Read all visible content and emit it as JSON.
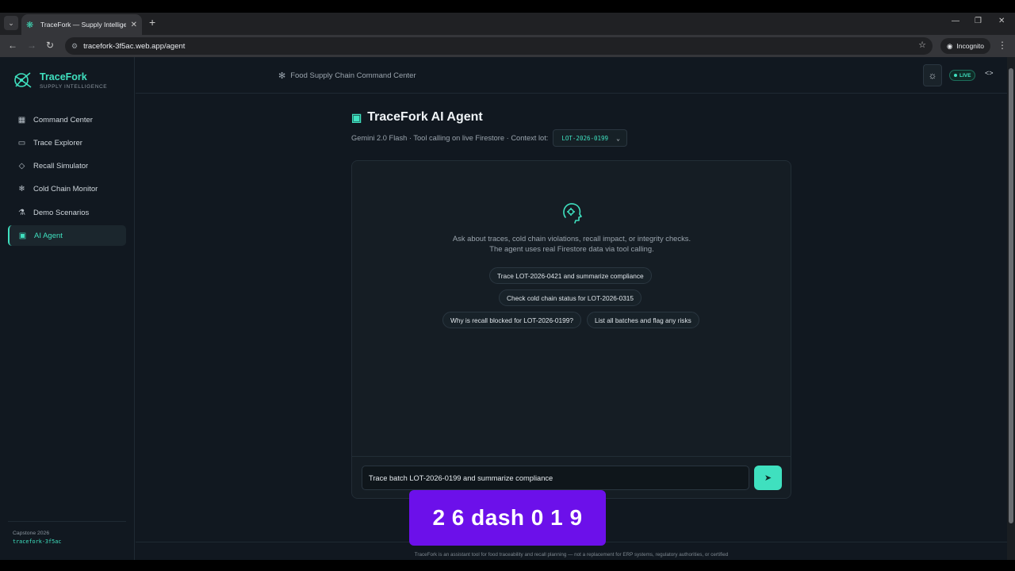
{
  "browser": {
    "tab_title": "TraceFork — Supply Intelligence",
    "url": "tracefork-3f5ac.web.app/agent",
    "incognito_label": "Incognito"
  },
  "sidebar": {
    "brand_name": "TraceFork",
    "brand_sub": "SUPPLY INTELLIGENCE",
    "items": [
      {
        "label": "Command Center",
        "icon": "grid-icon",
        "active": false
      },
      {
        "label": "Trace Explorer",
        "icon": "monitor-icon",
        "active": false
      },
      {
        "label": "Recall Simulator",
        "icon": "diamond-icon",
        "active": false
      },
      {
        "label": "Cold Chain Monitor",
        "icon": "snowflake-icon",
        "active": false
      },
      {
        "label": "Demo Scenarios",
        "icon": "flask-icon",
        "active": false
      },
      {
        "label": "AI Agent",
        "icon": "robot-icon",
        "active": true
      }
    ],
    "footer_caption": "Capstone 2026",
    "footer_project": "tracefork-3f5ac"
  },
  "header": {
    "title": "Food Supply Chain Command Center",
    "live_label": "LIVE",
    "accent": "#3fe0bf"
  },
  "agent": {
    "title": "TraceFork AI Agent",
    "subtitle": "Gemini 2.0 Flash · Tool calling on live Firestore · Context lot:",
    "context_lot": "LOT-2026-0199",
    "intro": "Ask about traces, cold chain violations, recall impact, or integrity checks. The agent uses real Firestore data via tool calling.",
    "suggestions": [
      "Trace LOT-2026-0421 and summarize compliance",
      "Check cold chain status for LOT-2026-0315",
      "Why is recall blocked for LOT-2026-0199?",
      "List all batches and flag any risks"
    ],
    "input_value": "Trace batch LOT-2026-0199 and summarize compliance"
  },
  "caption": "2 6 dash 0 1 9",
  "footer": {
    "disclaimer": "TraceFork is an assistant tool for food traceability and recall planning — not a replacement for ERP systems, regulatory authorities, or certified"
  }
}
